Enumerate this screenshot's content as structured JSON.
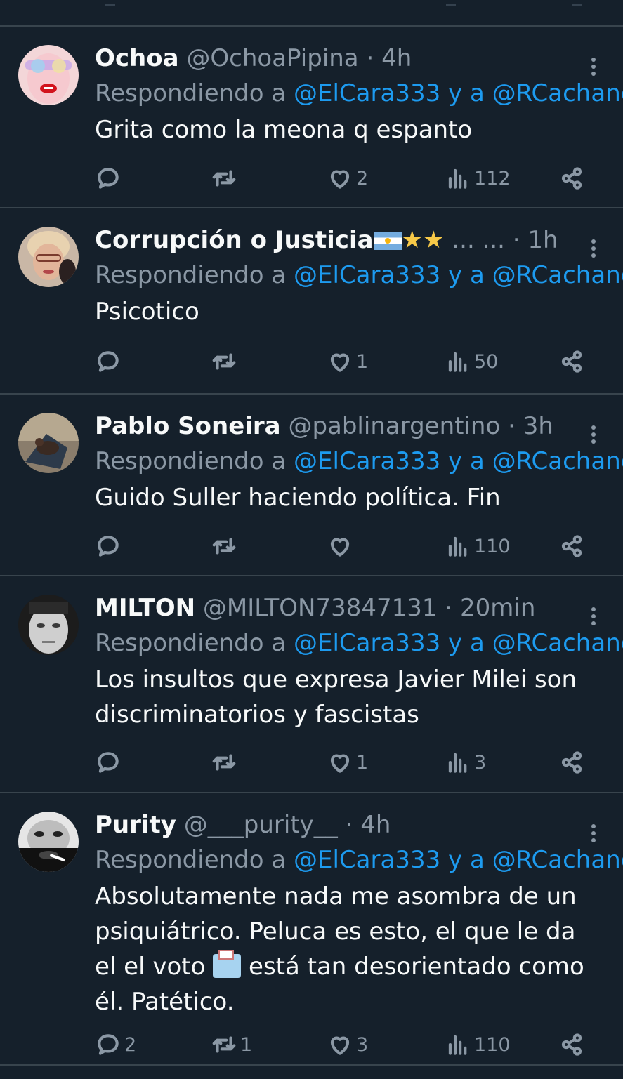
{
  "tweets": [
    {
      "name": "Ochoa",
      "handle": "@OchoaPipina",
      "dot": "·",
      "time": "4h",
      "reply_prefix": "Respondiendo a ",
      "mention1": "@ElCara333",
      "reply_mid": " y a ",
      "mention2": "@RCachanosky",
      "text": "Grita como la meona q espanto",
      "replies": "",
      "retweets": "",
      "likes": "2",
      "views": "112",
      "avatar": "pink-face-avatar"
    },
    {
      "name": "Corrupción o Justicia",
      "name_suffix": "... ...",
      "handle": "",
      "dot": "·",
      "time": "1h",
      "reply_prefix": "Respondiendo a ",
      "mention1": "@ElCara333",
      "reply_mid": " y a ",
      "mention2": "@RCachanosky",
      "text": "Psicotico",
      "replies": "",
      "retweets": "",
      "likes": "1",
      "views": "50",
      "avatar": "elderly-woman-avatar",
      "emoji": [
        "argentina-flag",
        "star",
        "star"
      ]
    },
    {
      "name": "Pablo Soneira",
      "handle": "@pablinargentino",
      "dot": "·",
      "time": "3h",
      "reply_prefix": "Respondiendo a ",
      "mention1": "@ElCara333",
      "reply_mid": " y a ",
      "mention2": "@RCachanosky",
      "text": "Guido Suller haciendo política. Fin",
      "replies": "",
      "retweets": "",
      "likes": "",
      "views": "110",
      "avatar": "dog-photo-avatar"
    },
    {
      "name": "MILTON",
      "handle": "@MILTON73847131",
      "dot": "·",
      "time": "20min",
      "reply_prefix": "Respondiendo a ",
      "mention1": "@ElCara333",
      "reply_mid": " y a ",
      "mention2": "@RCachanosky",
      "text_lines": [
        "Los insultos que expresa Javier Milei son",
        "discriminatorios y fascistas"
      ],
      "replies": "",
      "retweets": "",
      "likes": "1",
      "views": "3",
      "avatar": "man-face-avatar"
    },
    {
      "name": "Purity",
      "handle": "@___purity__",
      "dot": "·",
      "time": "4h",
      "reply_prefix": "Respondiendo a ",
      "mention1": "@ElCara333",
      "reply_mid": " y a ",
      "mention2": "@RCachanosky",
      "text_lines": [
        "Absolutamente nada me asombra de un",
        "psiquiátrico. Peluca es esto, el que le da",
        "el el voto",
        "está tan desorientado como",
        "él. Patético."
      ],
      "replies": "2",
      "retweets": "1",
      "likes": "3",
      "views": "110",
      "avatar": "bw-face-avatar",
      "emoji": [
        "ballot-box"
      ]
    }
  ],
  "colors": {
    "background": "#15202b",
    "divider": "#38444d",
    "muted": "#8b98a5",
    "accent": "#1d9bf0",
    "text": "#f7f9f9"
  },
  "icons": [
    "reply-icon",
    "retweet-icon",
    "like-icon",
    "views-icon",
    "share-icon",
    "more-icon"
  ]
}
